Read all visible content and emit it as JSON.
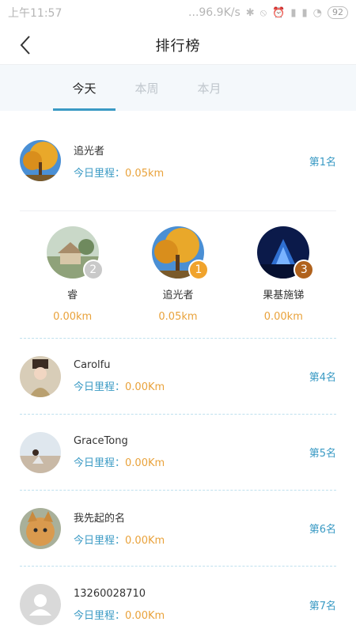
{
  "status": {
    "time": "上午11:57",
    "network": "...96.9K/s",
    "battery": "92"
  },
  "nav": {
    "title": "排行榜"
  },
  "tabs": [
    "今天",
    "本周",
    "本月"
  ],
  "me": {
    "name": "追光者",
    "km_label": "今日里程：",
    "km_value": "0.05km",
    "rank": "第1名"
  },
  "podium": [
    {
      "name": "睿",
      "km": "0.00km",
      "rank": "2",
      "badge_color": "#c9c9c9"
    },
    {
      "name": "追光者",
      "km": "0.05km",
      "rank": "1",
      "badge_color": "#f0a32c"
    },
    {
      "name": "果基施锑",
      "km": "0.00km",
      "rank": "3",
      "badge_color": "#b0621d"
    }
  ],
  "rows": [
    {
      "name": "Carolfu",
      "km_label": "今日里程：",
      "km_value": "0.00Km",
      "rank": "第4名"
    },
    {
      "name": "GraceTong",
      "km_label": "今日里程：",
      "km_value": "0.00Km",
      "rank": "第5名"
    },
    {
      "name": "我先起的名",
      "km_label": "今日里程：",
      "km_value": "0.00Km",
      "rank": "第6名"
    },
    {
      "name": "13260028710",
      "km_label": "今日里程：",
      "km_value": "0.00Km",
      "rank": "第7名"
    }
  ],
  "colors": {
    "accent": "#3a9ac4",
    "distance": "#e9a23b"
  }
}
